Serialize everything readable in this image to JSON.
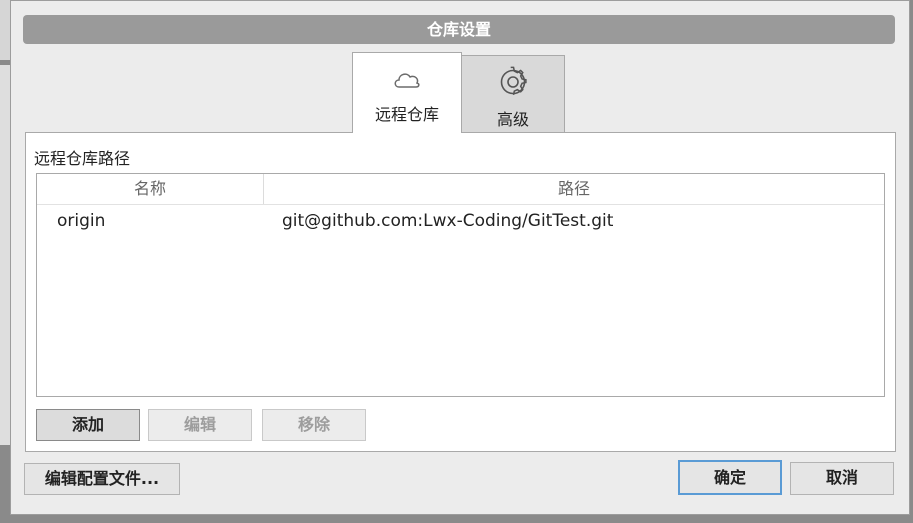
{
  "dialog": {
    "title": "仓库设置"
  },
  "tabs": [
    {
      "label": "远程仓库",
      "icon": "cloud-icon",
      "active": true
    },
    {
      "label": "高级",
      "icon": "gear-icon",
      "active": false
    }
  ],
  "remote": {
    "section_title": "远程仓库路径",
    "columns": [
      "名称",
      "路径"
    ],
    "rows": [
      {
        "name": "origin",
        "path": "git@github.com:Lwx-Coding/GitTest.git"
      }
    ],
    "buttons": {
      "add": "添加",
      "edit": "编辑",
      "remove": "移除"
    }
  },
  "footer": {
    "edit_config": "编辑配置文件...",
    "ok": "确定",
    "cancel": "取消"
  },
  "colors": {
    "titlebar": "#9a9a9a",
    "focus_border": "#5a9bd5"
  }
}
